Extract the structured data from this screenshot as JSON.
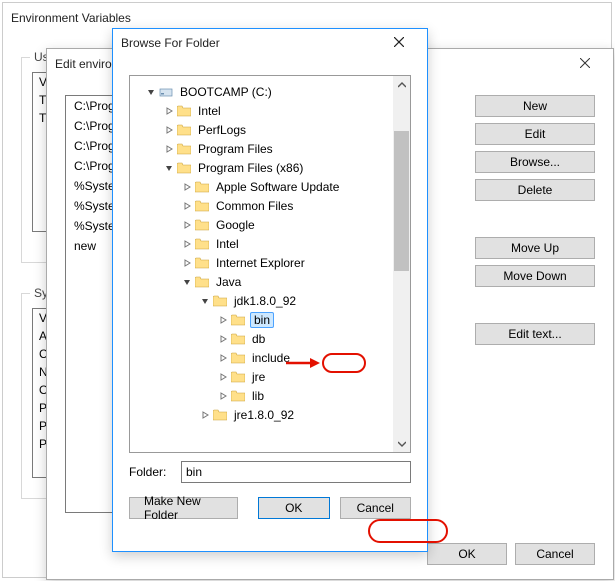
{
  "env_dialog": {
    "title": "Environment Variables",
    "user_group": "User",
    "user_cols": [
      "Va",
      "TE",
      "TM"
    ],
    "sys_group": "Syste",
    "sys_cols": [
      "Va",
      "Ap",
      "Co",
      "NU",
      "OS",
      "Pa",
      "PA",
      "PR"
    ],
    "ok": "OK",
    "cancel": "Cancel"
  },
  "edit_dialog": {
    "title": "Edit environ",
    "paths": [
      "C:\\Prog",
      "C:\\Prog",
      "C:\\Prog",
      "C:\\Prog",
      "%Syster",
      "%Syster",
      "%Syster",
      "new"
    ],
    "btn_new": "New",
    "btn_edit": "Edit",
    "btn_browse": "Browse...",
    "btn_delete": "Delete",
    "btn_moveup": "Move Up",
    "btn_movedown": "Move Down",
    "btn_edittext": "Edit text...",
    "ok": "OK",
    "cancel": "Cancel"
  },
  "browse_dialog": {
    "title": "Browse For Folder",
    "folder_label": "Folder:",
    "folder_value": "bin",
    "btn_makenew": "Make New Folder",
    "btn_ok": "OK",
    "btn_cancel": "Cancel",
    "tree": [
      {
        "depth": 0,
        "tw": "v",
        "icon": "drive",
        "label": "BOOTCAMP (C:)"
      },
      {
        "depth": 1,
        "tw": ">",
        "icon": "folder",
        "label": "Intel"
      },
      {
        "depth": 1,
        "tw": ">",
        "icon": "folder",
        "label": "PerfLogs"
      },
      {
        "depth": 1,
        "tw": ">",
        "icon": "folder",
        "label": "Program Files"
      },
      {
        "depth": 1,
        "tw": "v",
        "icon": "folder",
        "label": "Program Files (x86)"
      },
      {
        "depth": 2,
        "tw": ">",
        "icon": "folder",
        "label": "Apple Software Update"
      },
      {
        "depth": 2,
        "tw": ">",
        "icon": "folder",
        "label": "Common Files"
      },
      {
        "depth": 2,
        "tw": ">",
        "icon": "folder",
        "label": "Google"
      },
      {
        "depth": 2,
        "tw": ">",
        "icon": "folder",
        "label": "Intel"
      },
      {
        "depth": 2,
        "tw": ">",
        "icon": "folder",
        "label": "Internet Explorer"
      },
      {
        "depth": 2,
        "tw": "v",
        "icon": "folder",
        "label": "Java"
      },
      {
        "depth": 3,
        "tw": "v",
        "icon": "folder",
        "label": "jdk1.8.0_92"
      },
      {
        "depth": 4,
        "tw": ">",
        "icon": "folder",
        "label": "bin",
        "selected": true
      },
      {
        "depth": 4,
        "tw": ">",
        "icon": "folder",
        "label": "db"
      },
      {
        "depth": 4,
        "tw": ">",
        "icon": "folder",
        "label": "include"
      },
      {
        "depth": 4,
        "tw": ">",
        "icon": "folder",
        "label": "jre"
      },
      {
        "depth": 4,
        "tw": ">",
        "icon": "folder",
        "label": "lib"
      },
      {
        "depth": 3,
        "tw": ">",
        "icon": "folder",
        "label": "jre1.8.0_92"
      }
    ]
  }
}
